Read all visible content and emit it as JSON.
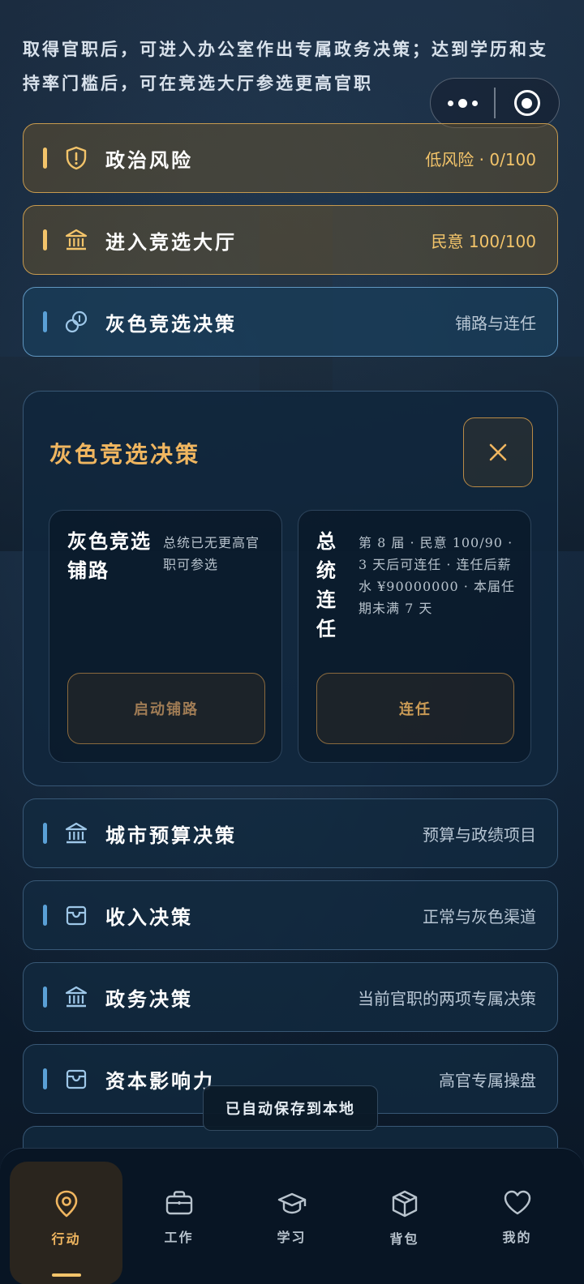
{
  "intro": "取得官职后，可进入办公室作出专属政务决策；达到学历和支持率门槛后，可在竞选大厅参选更高官职",
  "capsule": {
    "menu_icon": "more-dots-icon",
    "close_icon": "target-icon"
  },
  "rows": [
    {
      "title": "政治风险",
      "meta": "低风险 · 0/100",
      "icon": "shield-alert-icon",
      "style": "gold"
    },
    {
      "title": "进入竞选大厅",
      "meta": "民意 100/100",
      "icon": "bank-icon",
      "style": "gold"
    },
    {
      "title": "灰色竞选决策",
      "meta": "铺路与连任",
      "icon": "coins-icon",
      "style": "blue-active"
    },
    {
      "title": "城市预算决策",
      "meta": "预算与政绩项目",
      "icon": "bank-icon",
      "style": "blue"
    },
    {
      "title": "收入决策",
      "meta": "正常与灰色渠道",
      "icon": "wallet-icon",
      "style": "blue"
    },
    {
      "title": "政务决策",
      "meta": "当前官职的两项专属决策",
      "icon": "bank-icon",
      "style": "blue"
    },
    {
      "title": "资本影响力",
      "meta": "高官专属操盘",
      "icon": "wallet-icon",
      "style": "blue"
    }
  ],
  "panel": {
    "title": "灰色竞选决策",
    "close_icon": "close-icon",
    "cards": [
      {
        "title": "灰色竞选铺路",
        "desc": "总统已无更高官职可参选",
        "button": "启动铺路"
      },
      {
        "title": "总统连任",
        "desc": "第 8 届 · 民意 100/90 · 3 天后可连任 · 连任后薪水 ¥90000000 · 本届任期未满 7 天",
        "button": "连任"
      }
    ]
  },
  "toast": "已自动保存到本地",
  "tabs": [
    {
      "label": "行动",
      "icon": "location-pin-icon",
      "active": true
    },
    {
      "label": "工作",
      "icon": "briefcase-icon",
      "active": false
    },
    {
      "label": "学习",
      "icon": "graduation-cap-icon",
      "active": false
    },
    {
      "label": "背包",
      "icon": "package-icon",
      "active": false
    },
    {
      "label": "我的",
      "icon": "heart-icon",
      "active": false
    }
  ],
  "colors": {
    "gold": "#f3c46a",
    "panel_title": "#f0b660",
    "blue_bar": "#5aa0d6"
  }
}
